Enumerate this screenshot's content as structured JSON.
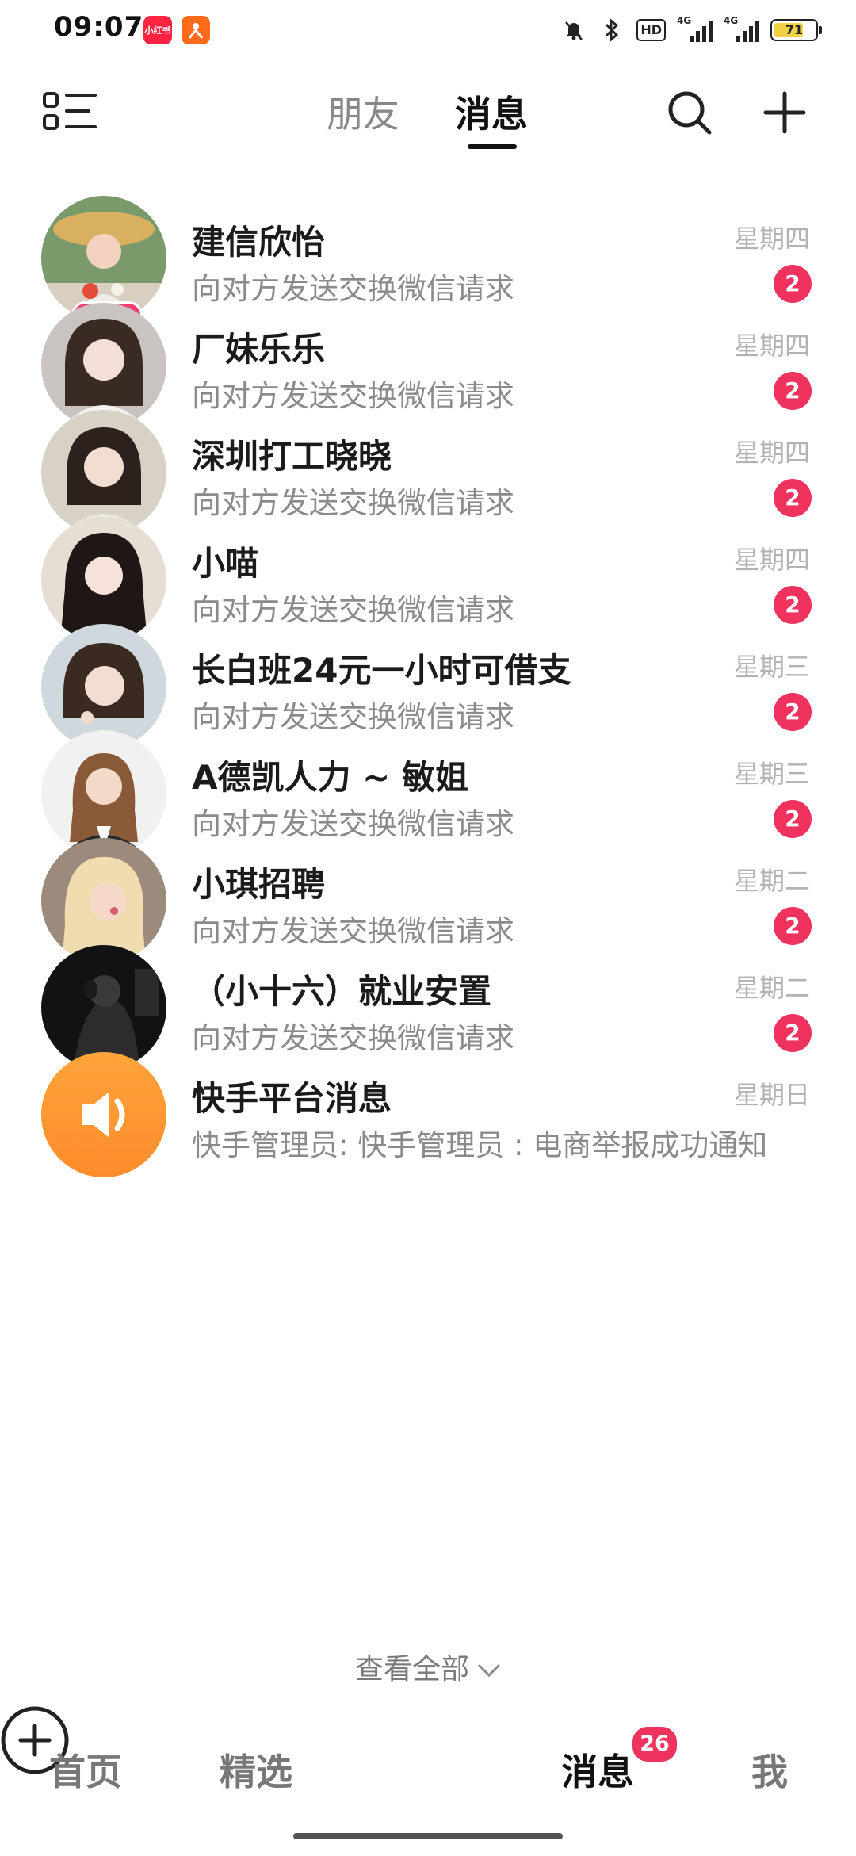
{
  "status_bar": {
    "time": "09:07",
    "app_icon_1_text": "小红书",
    "hd_label": "HD",
    "signal_1_label": "4G",
    "signal_2_label": "4G",
    "battery_percent": "71"
  },
  "header": {
    "tab_friends": "朋友",
    "tab_messages": "消息",
    "active_tab": "消息"
  },
  "conversations": [
    {
      "name": "建信欣怡",
      "preview": "向对方发送交换微信请求",
      "time": "星期四",
      "unread": "2",
      "live_label": "直播中"
    },
    {
      "name": "厂妹乐乐",
      "preview": "向对方发送交换微信请求",
      "time": "星期四",
      "unread": "2"
    },
    {
      "name": "深圳打工晓晓",
      "preview": "向对方发送交换微信请求",
      "time": "星期四",
      "unread": "2"
    },
    {
      "name": "小喵",
      "preview": "向对方发送交换微信请求",
      "time": "星期四",
      "unread": "2"
    },
    {
      "name": "长白班24元一小时可借支",
      "preview": "向对方发送交换微信请求",
      "time": "星期三",
      "unread": "2"
    },
    {
      "name": "A德凯人力 ~ 敏姐",
      "preview": "向对方发送交换微信请求",
      "time": "星期三",
      "unread": "2"
    },
    {
      "name": "小琪招聘",
      "preview": "向对方发送交换微信请求",
      "time": "星期二",
      "unread": "2"
    },
    {
      "name": "（小十六）就业安置",
      "preview": "向对方发送交换微信请求",
      "time": "星期二",
      "unread": "2"
    },
    {
      "name": "快手平台消息",
      "preview": "快手管理员: 快手管理员 : 电商举报成功通知",
      "time": "星期日"
    }
  ],
  "view_all_label": "查看全部",
  "bottom_nav": {
    "home": "首页",
    "featured": "精选",
    "messages": "消息",
    "messages_badge": "26",
    "me": "我"
  },
  "colors": {
    "accent_red": "#f0325f",
    "live_pink": "#f43f6e",
    "system_orange": "#ff9a2e"
  }
}
